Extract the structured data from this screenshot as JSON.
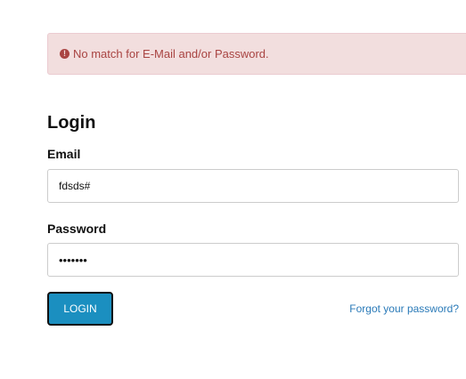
{
  "alert": {
    "icon": "exclamation-circle-icon",
    "message": "No match for E-Mail and/or Password.",
    "background_color": "#f2dede",
    "text_color": "#a94442"
  },
  "form": {
    "title": "Login",
    "email_label": "Email",
    "email_value": "fdsds#",
    "password_label": "Password",
    "password_value": "•••••••",
    "login_button_label": "LOGIN",
    "forgot_password_label": "Forgot your password?"
  },
  "colors": {
    "primary_button": "#1b8fc0",
    "link": "#2a7ab8"
  }
}
